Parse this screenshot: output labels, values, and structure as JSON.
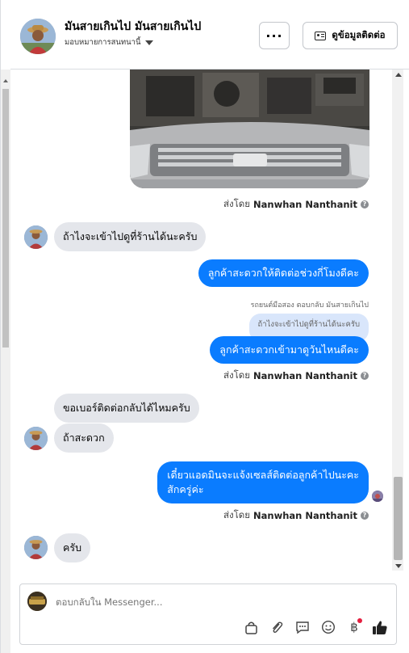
{
  "header": {
    "contact_name": "มันสายเกินไป มันสายเกินไป",
    "assign_label": "มอบหมายการสนทนานี้",
    "more_label": "···",
    "contact_info_label": "ดูข้อมูลติดต่อ"
  },
  "messages": {
    "sent_by_prefix": "ส่งโดย",
    "sender_name": "Nanwhan Nanthanit",
    "m1": "ถ้าไงจะเข้าไปดูที่ร้านได้นะครับ",
    "m2": "ลูกค้าสะดวกให้ติดต่อช่วงกี่โมงดีคะ",
    "reply_note": "รถยนต์มือสอง ตอบกลับ มันสายเกินไป",
    "quoted": "ถ้าไงจะเข้าไปดูที่ร้านได้นะครับ",
    "m3": "ลูกค้าสะดวกเข้ามาดูวันไหนดีคะ",
    "m4": "ขอเบอร์ติดต่อกลับได้ไหมครับ",
    "m5": "ถ้าสะดวก",
    "m6_line1": "เดี๋ยวแอดมินจะแจ้งเซลส์ติดต่อลูกค้าไปนะคะ",
    "m6_line2": "สักครู่ค่ะ",
    "m7": "ครับ"
  },
  "composer": {
    "placeholder": "ตอบกลับใน Messenger...",
    "tools": [
      "bag-icon",
      "paperclip-icon",
      "quick-reply-icon",
      "emoji-icon",
      "baht-icon",
      "like-icon"
    ]
  },
  "colors": {
    "outgoing_bubble": "#0a7cff",
    "incoming_bubble": "#e4e6eb",
    "notification_dot": "#e41e3f"
  }
}
